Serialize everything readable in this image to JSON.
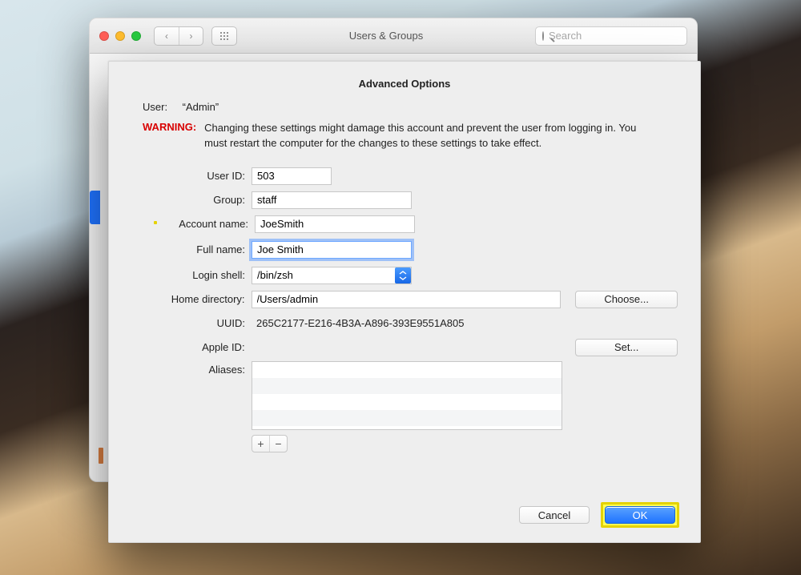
{
  "toolbar": {
    "window_title": "Users & Groups",
    "search_placeholder": "Search",
    "back": "‹",
    "forward": "›"
  },
  "sheet": {
    "title": "Advanced Options",
    "user_label": "User:",
    "user_value": "“Admin”",
    "warning_label": "WARNING:",
    "warning_text": "Changing these settings might damage this account and prevent the user from logging in. You must restart the computer for the changes to these settings to take effect.",
    "labels": {
      "user_id": "User ID:",
      "group": "Group:",
      "account_name": "Account name:",
      "full_name": "Full name:",
      "login_shell": "Login shell:",
      "home_dir": "Home directory:",
      "uuid": "UUID:",
      "apple_id": "Apple ID:",
      "aliases": "Aliases:"
    },
    "values": {
      "user_id": "503",
      "group": "staff",
      "account_name": "JoeSmith",
      "full_name": "Joe Smith",
      "login_shell": "/bin/zsh",
      "home_dir": "/Users/admin",
      "uuid": "265C2177-E216-4B3A-A896-393E9551A805",
      "apple_id": ""
    },
    "buttons": {
      "choose": "Choose...",
      "set": "Set...",
      "cancel": "Cancel",
      "ok": "OK",
      "plus": "+",
      "minus": "−"
    }
  }
}
